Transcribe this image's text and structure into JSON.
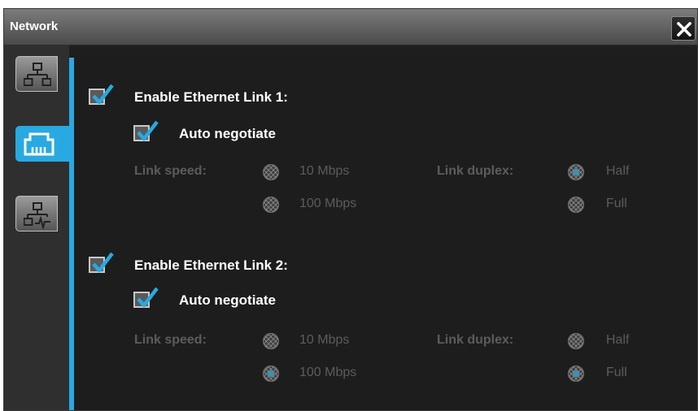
{
  "window": {
    "title": "Network"
  },
  "colors": {
    "accent": "#29a9e1",
    "window_bg": "#1e1e1e",
    "disabled_text": "#5c5c5c"
  },
  "sidebar": {
    "tabs": [
      {
        "icon": "network-topology-icon",
        "active": false
      },
      {
        "icon": "ethernet-port-icon",
        "active": true
      },
      {
        "icon": "network-activity-icon",
        "active": false
      }
    ]
  },
  "link1": {
    "enable_label": "Enable Ethernet Link 1:",
    "enabled": true,
    "auto_label": "Auto negotiate",
    "auto_negotiate": true,
    "speed_label": "Link speed:",
    "speed_options": [
      "10 Mbps",
      "100 Mbps"
    ],
    "speed_selected": "10 Mbps",
    "duplex_label": "Link duplex:",
    "duplex_options": [
      "Half",
      "Full"
    ],
    "duplex_selected": "Half"
  },
  "link2": {
    "enable_label": "Enable Ethernet Link 2:",
    "enabled": true,
    "auto_label": "Auto negotiate",
    "auto_negotiate": true,
    "speed_label": "Link speed:",
    "speed_options": [
      "10 Mbps",
      "100 Mbps"
    ],
    "speed_selected": "100 Mbps",
    "duplex_label": "Link duplex:",
    "duplex_options": [
      "Half",
      "Full"
    ],
    "duplex_selected": "Full"
  }
}
